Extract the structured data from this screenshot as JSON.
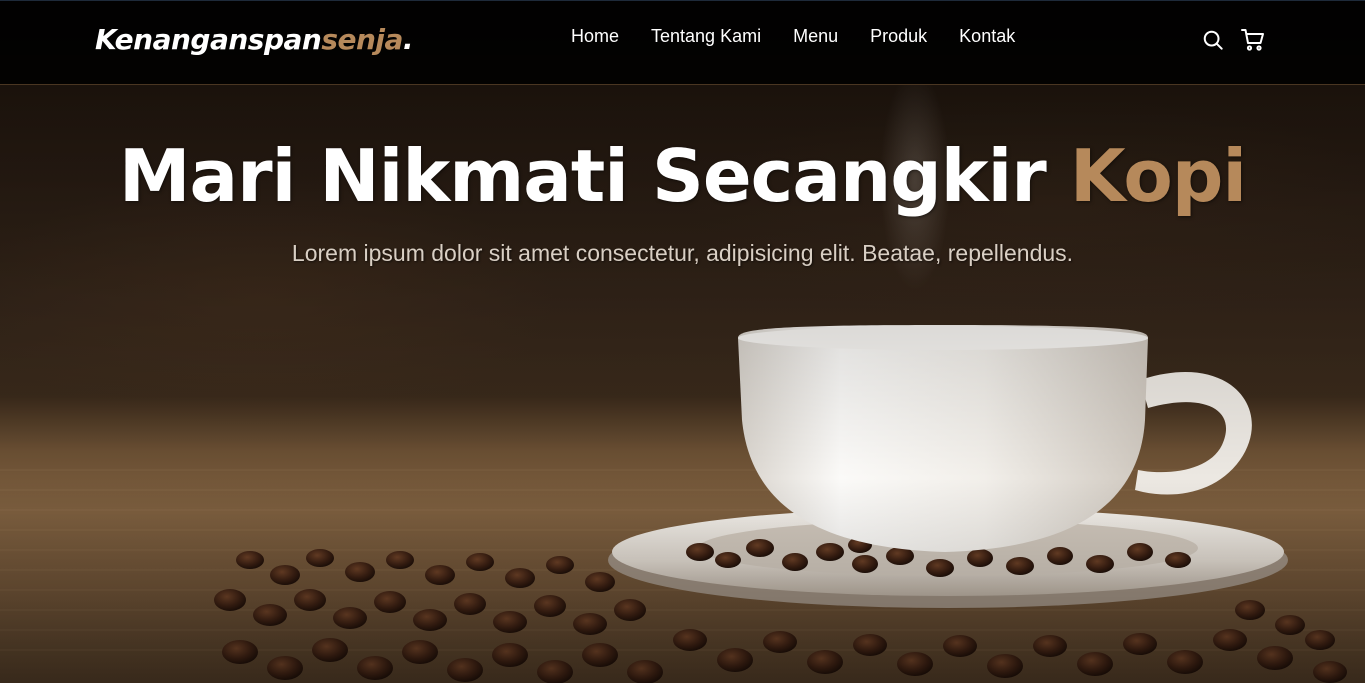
{
  "brand": {
    "logo_main": "Kenanganspan",
    "logo_accent": "senja",
    "logo_dot": "."
  },
  "nav": {
    "items": [
      {
        "label": "Home"
      },
      {
        "label": "Tentang Kami"
      },
      {
        "label": "Menu"
      },
      {
        "label": "Produk"
      },
      {
        "label": "Kontak"
      }
    ],
    "icons": [
      "search-icon",
      "shopping-cart-icon"
    ]
  },
  "hero": {
    "title_main": "Mari Nikmati Secangkir ",
    "title_accent": "Kopi",
    "subtitle": "Lorem ipsum dolor sit amet consectetur, adipisicing elit. Beatae, repellendus.",
    "image_description": "white coffee cup on saucer with roasted coffee beans on burlap"
  },
  "colors": {
    "accent": "#b6895b",
    "navbar_bg": "#000000",
    "text": "#ffffff"
  }
}
